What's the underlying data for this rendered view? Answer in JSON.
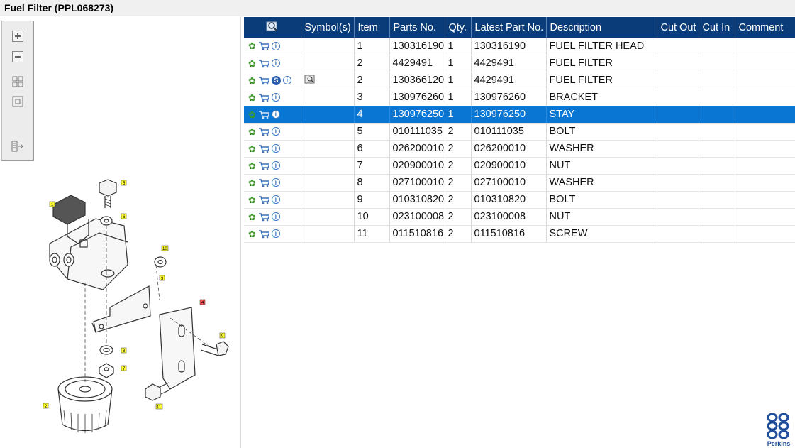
{
  "window": {
    "title": "Fuel Filter (PPL068273)"
  },
  "toolbar": {
    "buttons": [
      "zoom-in",
      "zoom-out",
      "fit-all",
      "fit-window",
      "export"
    ]
  },
  "table": {
    "headers": [
      "",
      "Symbol(s)",
      "Item",
      "Parts No.",
      "Qty.",
      "Latest Part No.",
      "Description",
      "Cut Out",
      "Cut In",
      "Comment"
    ],
    "rows": [
      {
        "item": "1",
        "part": "130316190",
        "qty": "1",
        "latest": "130316190",
        "desc": "FUEL FILTER HEAD",
        "s": false,
        "sym": false,
        "selected": false
      },
      {
        "item": "2",
        "part": "4429491",
        "qty": "1",
        "latest": "4429491",
        "desc": "FUEL FILTER",
        "s": false,
        "sym": false,
        "selected": false
      },
      {
        "item": "2",
        "part": "130366120",
        "qty": "1",
        "latest": "4429491",
        "desc": "FUEL FILTER",
        "s": true,
        "sym": true,
        "selected": false
      },
      {
        "item": "3",
        "part": "130976260",
        "qty": "1",
        "latest": "130976260",
        "desc": "BRACKET",
        "s": false,
        "sym": false,
        "selected": false
      },
      {
        "item": "4",
        "part": "130976250",
        "qty": "1",
        "latest": "130976250",
        "desc": "STAY",
        "s": false,
        "sym": false,
        "selected": true
      },
      {
        "item": "5",
        "part": "010111035",
        "qty": "2",
        "latest": "010111035",
        "desc": "BOLT",
        "s": false,
        "sym": false,
        "selected": false
      },
      {
        "item": "6",
        "part": "026200010",
        "qty": "2",
        "latest": "026200010",
        "desc": "WASHER",
        "s": false,
        "sym": false,
        "selected": false
      },
      {
        "item": "7",
        "part": "020900010",
        "qty": "2",
        "latest": "020900010",
        "desc": "NUT",
        "s": false,
        "sym": false,
        "selected": false
      },
      {
        "item": "8",
        "part": "027100010",
        "qty": "2",
        "latest": "027100010",
        "desc": "WASHER",
        "s": false,
        "sym": false,
        "selected": false
      },
      {
        "item": "9",
        "part": "010310820",
        "qty": "2",
        "latest": "010310820",
        "desc": "BOLT",
        "s": false,
        "sym": false,
        "selected": false
      },
      {
        "item": "10",
        "part": "023100008",
        "qty": "2",
        "latest": "023100008",
        "desc": "NUT",
        "s": false,
        "sym": false,
        "selected": false
      },
      {
        "item": "11",
        "part": "011510816",
        "qty": "2",
        "latest": "011510816",
        "desc": "SCREW",
        "s": false,
        "sym": false,
        "selected": false
      }
    ]
  },
  "diagram": {
    "callouts": [
      "1",
      "2",
      "3",
      "4",
      "5",
      "6",
      "7",
      "8",
      "9",
      "10",
      "11"
    ]
  },
  "logo": {
    "text": "Perkins"
  },
  "colors": {
    "header": "#0a3c7a",
    "selected": "#0a76d4",
    "gear": "#3b9a2a"
  }
}
